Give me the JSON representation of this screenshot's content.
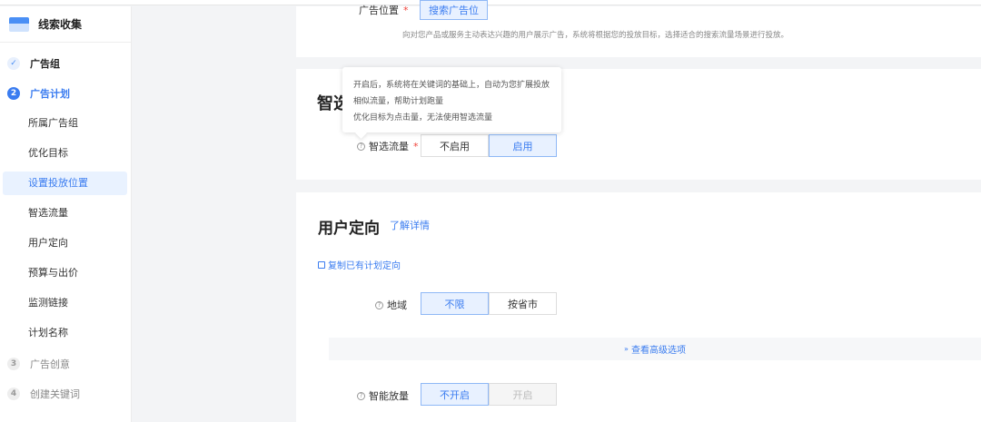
{
  "sidebar": {
    "brand": "线索收集",
    "steps": [
      {
        "num": "✓",
        "label": "广告组"
      },
      {
        "num": "2",
        "label": "广告计划"
      },
      {
        "num": "3",
        "label": "广告创意"
      },
      {
        "num": "4",
        "label": "创建关键词"
      }
    ],
    "sub_items": [
      "所属广告组",
      "优化目标",
      "设置投放位置",
      "智选流量",
      "用户定向",
      "预算与出价",
      "监测链接",
      "计划名称"
    ]
  },
  "placement": {
    "label": "广告位置",
    "button": "搜索广告位",
    "description": "向对您产品或服务主动表达兴趣的用户展示广告，系统将根据您的投放目标，选择适合的搜索流量场景进行投放。"
  },
  "smart_traffic": {
    "title": "智选流量",
    "label": "智选流量",
    "options": [
      "不启用",
      "启用"
    ],
    "selected": "启用",
    "tooltip": [
      "开启后，系统将在关键词的基础上，自动为您扩展投放",
      "相似流量，帮助计划跑量",
      "优化目标为点击量，无法使用智选流量"
    ]
  },
  "targeting": {
    "title": "用户定向",
    "learn_more": "了解详情",
    "copy_link": "复制已有计划定向",
    "region": {
      "label": "地域",
      "options": [
        "不限",
        "按省市"
      ],
      "selected": "不限"
    },
    "advanced": "查看高级选项",
    "smart_expand": {
      "label": "智能放量",
      "options": [
        "不开启",
        "开启"
      ],
      "selected": "不开启"
    }
  }
}
